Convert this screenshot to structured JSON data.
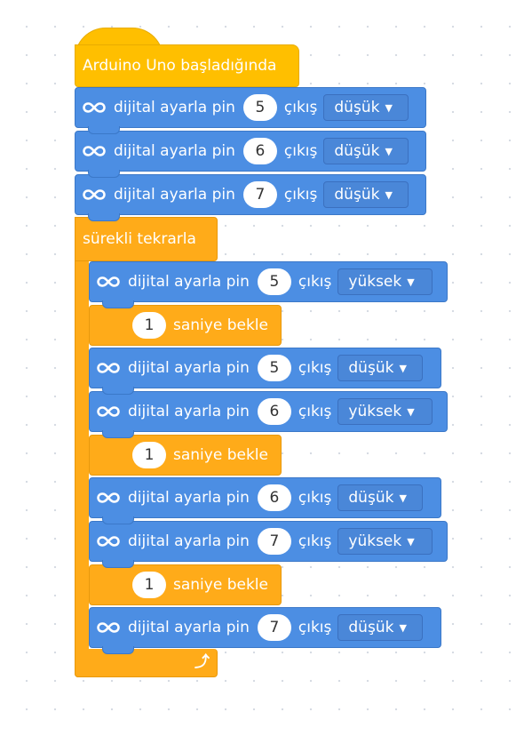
{
  "hat": {
    "label": "Arduino Uno başladığında"
  },
  "block_labels": {
    "set_digital": "dijital ayarla pin",
    "output": "çıkış"
  },
  "setup_blocks": [
    {
      "pin": "5",
      "level": "düşük"
    },
    {
      "pin": "6",
      "level": "düşük"
    },
    {
      "pin": "7",
      "level": "düşük"
    }
  ],
  "loop": {
    "label": "sürekli tekrarla",
    "icon": "loop-arrow-icon",
    "body": [
      {
        "type": "set",
        "pin": "5",
        "level": "yüksek"
      },
      {
        "type": "wait",
        "seconds": "1",
        "label": "saniye bekle"
      },
      {
        "type": "set",
        "pin": "5",
        "level": "düşük"
      },
      {
        "type": "set",
        "pin": "6",
        "level": "yüksek"
      },
      {
        "type": "wait",
        "seconds": "1",
        "label": "saniye bekle"
      },
      {
        "type": "set",
        "pin": "6",
        "level": "düşük"
      },
      {
        "type": "set",
        "pin": "7",
        "level": "yüksek"
      },
      {
        "type": "wait",
        "seconds": "1",
        "label": "saniye bekle"
      },
      {
        "type": "set",
        "pin": "7",
        "level": "düşük"
      }
    ]
  },
  "colors": {
    "event_block": "#ffbf00",
    "control_block": "#ffab19",
    "arduino_block": "#4c8ee3",
    "canvas_bg": "#ffffff"
  }
}
